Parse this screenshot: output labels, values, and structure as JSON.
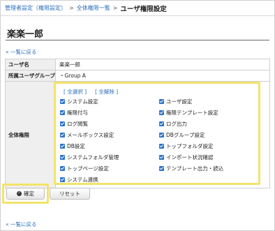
{
  "breadcrumb": {
    "item1": "管理者設定（権限設定）",
    "sep1": ">",
    "item2": "全体権限一覧",
    "sep2": ">",
    "current": "ユーザ権限設定"
  },
  "page_title": "楽楽一郎",
  "back_link": "« 一覧に戻る",
  "info": {
    "user_label": "ユーザ名",
    "user_value": "楽楽一郎",
    "group_label": "所属ユーザグループ",
    "group_value": "・Group A",
    "perm_label": "全体権限"
  },
  "select_all": "全選択",
  "deselect_all": "全解除",
  "bracket_open": "[",
  "bracket_close": "]",
  "permissions_left": [
    {
      "label": "システム設定",
      "checked": true
    },
    {
      "label": "権限付与",
      "checked": true
    },
    {
      "label": "ログ閲覧",
      "checked": true
    },
    {
      "label": "メールボックス設定",
      "checked": true
    },
    {
      "label": "DB設定",
      "checked": true
    },
    {
      "label": "システムフォルダ管理",
      "checked": true
    },
    {
      "label": "トップページ設定",
      "checked": true
    },
    {
      "label": "システム連携",
      "checked": true
    }
  ],
  "permissions_right": [
    {
      "label": "ユーザ設定",
      "checked": true
    },
    {
      "label": "権限テンプレート設定",
      "checked": true
    },
    {
      "label": "ログ出力",
      "checked": true
    },
    {
      "label": "DBグループ設定",
      "checked": true
    },
    {
      "label": "トップフォルダ設定",
      "checked": true
    },
    {
      "label": "インポート状況確認",
      "checked": true
    },
    {
      "label": "テンプレート出力・読込",
      "checked": true
    }
  ],
  "buttons": {
    "confirm": "確定",
    "reset": "リセット"
  },
  "colors": {
    "link": "#2a6ebb",
    "checkbox": "#2b73c8",
    "highlight": "#f2e36b"
  }
}
